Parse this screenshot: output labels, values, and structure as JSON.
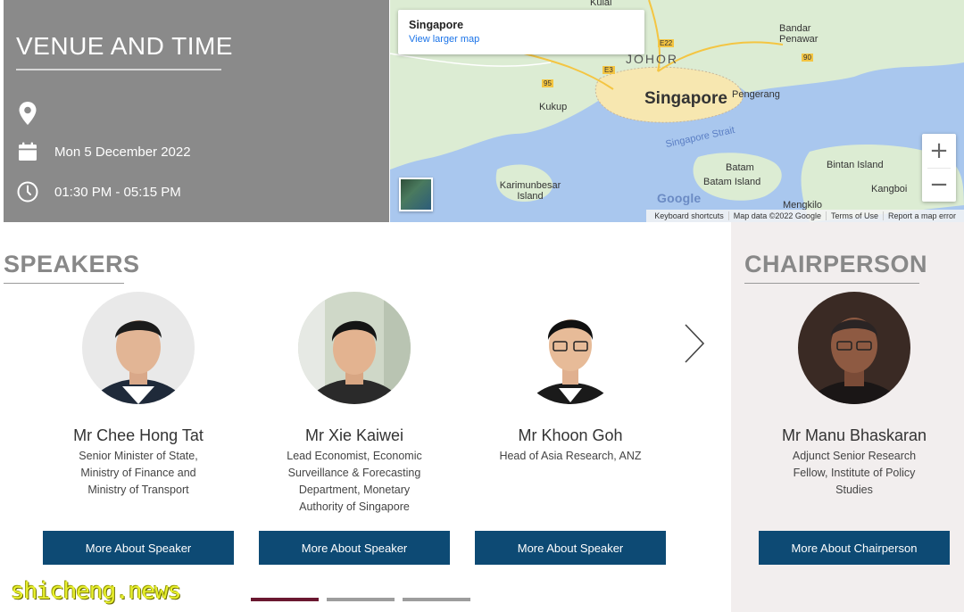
{
  "venue": {
    "title": "VENUE AND TIME",
    "location_icon": "map-pin-icon",
    "location_text": "",
    "date_icon": "calendar-icon",
    "date": "Mon 5 December 2022",
    "time_icon": "clock-icon",
    "time": "01:30 PM - 05:15 PM"
  },
  "map": {
    "card_title": "Singapore",
    "card_link": "View larger map",
    "zoom_in": "+",
    "zoom_out": "−",
    "labels": {
      "kulai": "Kulai",
      "bandar_penawar": "Bandar Penawar",
      "johor": "JOHOR",
      "singapore": "Singapore",
      "pengerang": "Pengerang",
      "kukup": "Kukup",
      "singapore_strait": "Singapore Strait",
      "batam": "Batam",
      "batam_island": "Batam Island",
      "bintan_island": "Bintan Island",
      "karimunbesar_island": "Karimunbesar Island",
      "kangboi": "Kangboi",
      "mengkilo": "Mengkilo",
      "e22": "E22",
      "e3": "E3",
      "r95": "95",
      "r90": "90"
    },
    "google": "Google",
    "footer": {
      "shortcuts": "Keyboard shortcuts",
      "mapdata": "Map data ©2022 Google",
      "terms": "Terms of Use",
      "report": "Report a map error"
    },
    "colors": {
      "water": "#a9c7ee",
      "land": "#dcecd3",
      "city": "#f7e7b0"
    }
  },
  "speakers_section": {
    "title": "SPEAKERS",
    "speakers": [
      {
        "name": "Mr Chee Hong Tat",
        "role": "Senior Minister of State, Ministry of Finance and Ministry of Transport",
        "button": "More About Speaker"
      },
      {
        "name": "Mr Xie Kaiwei",
        "role": "Lead Economist, Economic Surveillance & Forecasting Department, Monetary Authority of Singapore",
        "button": "More About Speaker"
      },
      {
        "name": "Mr Khoon Goh",
        "role": "Head of Asia Research, ANZ",
        "button": "More About Speaker"
      }
    ],
    "next_icon": "chevron-right-icon"
  },
  "chair_section": {
    "title": "CHAIRPERSON",
    "name": "Mr Manu Bhaskaran",
    "role": "Adjunct Senior Research Fellow, Institute of Policy Studies",
    "button": "More About Chairperson"
  },
  "watermark": "shicheng.news",
  "colors": {
    "button_bg": "#0d4a74",
    "venue_bg": "#8a8a8a",
    "chair_bg": "#f2eeee",
    "dot_active": "#6a1830",
    "dot_inactive": "#9d9d9d"
  }
}
